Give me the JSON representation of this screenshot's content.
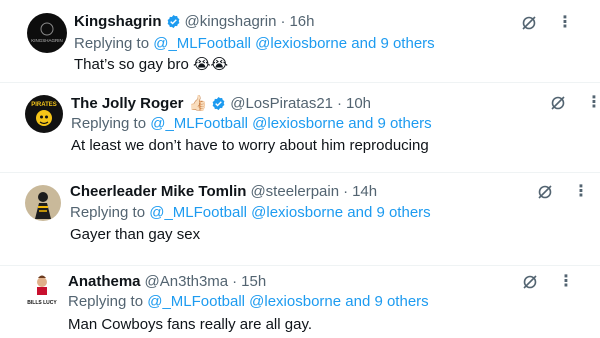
{
  "replies": [
    {
      "name": "Kingshagrin",
      "emoji": "",
      "verified": true,
      "handle": "@kingshagrin",
      "time": "16h",
      "replying_prefix": "Replying to",
      "mentions": "@_MLFootball @lexiosborne and 9 others",
      "text": "That’s so gay bro 😭😭",
      "avatar_text": "KINGSHAGRIN"
    },
    {
      "name": "The Jolly Roger",
      "emoji": "👍🏻",
      "verified": true,
      "handle": "@LosPiratas21",
      "time": "10h",
      "replying_prefix": "Replying to",
      "mentions": "@_MLFootball @lexiosborne and 9 others",
      "text": "At least we don’t have to worry about him reproducing",
      "avatar_text": "PIRATES"
    },
    {
      "name": "Cheerleader Mike Tomlin",
      "emoji": "",
      "verified": false,
      "handle": "@steelerpain",
      "time": "14h",
      "replying_prefix": "Replying to",
      "mentions": "@_MLFootball @lexiosborne and 9 others",
      "text": "Gayer than gay sex",
      "avatar_text": ""
    },
    {
      "name": "Anathema",
      "emoji": "",
      "verified": false,
      "handle": "@An3th3ma",
      "time": "15h",
      "replying_prefix": "Replying to",
      "mentions": "@_MLFootball @lexiosborne and 9 others",
      "text": "Man Cowboys fans really are all gay.",
      "avatar_text": "BILLS LUCY"
    }
  ],
  "separator": "·",
  "icons": {
    "verified": "verified-badge-icon",
    "grok": "grok-icon",
    "more": "more-icon"
  },
  "colors": {
    "link": "#1d9bf0",
    "verified": "#1d9bf0",
    "muted": "#536471",
    "text": "#0f1419"
  }
}
